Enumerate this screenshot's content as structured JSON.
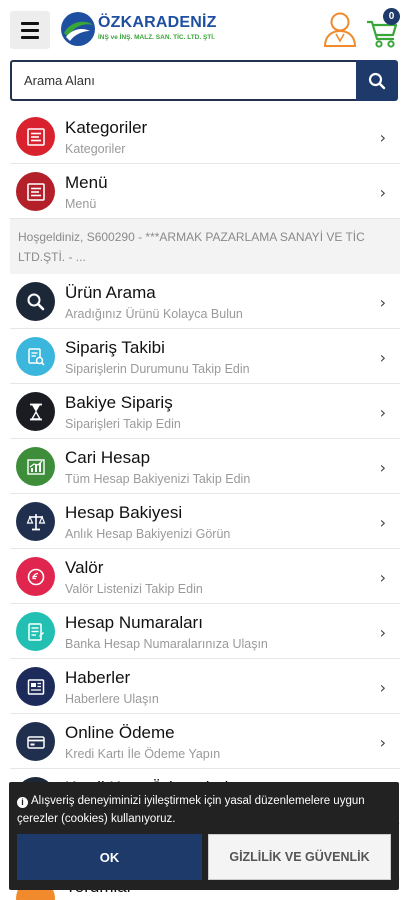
{
  "header": {
    "logo_name": "ÖZKARADENİZ",
    "logo_subtitle": "İNŞ ve İNŞ. MALZ. SAN. TİC. LTD. ŞTİ.",
    "cart_count": "0"
  },
  "search": {
    "placeholder": "Arama Alanı"
  },
  "menu_top": [
    {
      "title": "Kategoriler",
      "subtitle": "Kategoriler",
      "icon": "list-icon",
      "color": "#d9222e"
    },
    {
      "title": "Menü",
      "subtitle": "Menü",
      "icon": "list-icon",
      "color": "#b3202a"
    }
  ],
  "welcome_text": "Hoşgeldiniz, S600290 - ***ARMAK PAZARLAMA SANAYİ VE TİC LTD.ŞTİ. - ...",
  "menu_main": [
    {
      "title": "Ürün Arama",
      "subtitle": "Aradığınız Ürünü Kolayca Bulun",
      "icon": "search-icon",
      "color": "#1c2738"
    },
    {
      "title": "Sipariş Takibi",
      "subtitle": "Siparişlerin Durumunu Takip Edin",
      "icon": "document-search-icon",
      "color": "#3bb6dd"
    },
    {
      "title": "Bakiye Sipariş",
      "subtitle": "Siparişleri Takip Edin",
      "icon": "hourglass-icon",
      "color": "#1a1c22"
    },
    {
      "title": "Cari Hesap",
      "subtitle": "Tüm Hesap Bakiyenizi Takip Edin",
      "icon": "chart-icon",
      "color": "#3d8d3a"
    },
    {
      "title": "Hesap Bakiyesi",
      "subtitle": "Anlık Hesap Bakiyenizi Görün",
      "icon": "scale-icon",
      "color": "#1f2f4d"
    },
    {
      "title": "Valör",
      "subtitle": "Valör Listenizi Takip Edin",
      "icon": "coin-icon",
      "color": "#e0264e"
    },
    {
      "title": "Hesap Numaraları",
      "subtitle": "Banka Hesap Numaralarınıza Ulaşın",
      "icon": "notes-icon",
      "color": "#22c0b3"
    },
    {
      "title": "Haberler",
      "subtitle": "Haberlere Ulaşın",
      "icon": "newspaper-icon",
      "color": "#1c2b5a"
    },
    {
      "title": "Online Ödeme",
      "subtitle": "Kredi Kartı İle Ödeme Yapın",
      "icon": "card-icon",
      "color": "#1f2f4d"
    }
  ],
  "menu_partial": [
    {
      "title": "Kredi Kartı Ödemeleri"
    },
    {
      "title": "Yorumlar"
    }
  ],
  "cookie": {
    "text": "Alışveriş deneyiminizi iyileştirmek için yasal düzenlemelere uygun çerezler (cookies) kullanıyoruz.",
    "ok_label": "OK",
    "privacy_label": "GİZLİLİK VE GÜVENLİK"
  },
  "colors": {
    "primary": "#1d3a6b",
    "logo_blue": "#1e4fa0",
    "logo_green": "#3aa63a",
    "user_icon": "#f08a2c",
    "cart_icon": "#3aa63a"
  }
}
